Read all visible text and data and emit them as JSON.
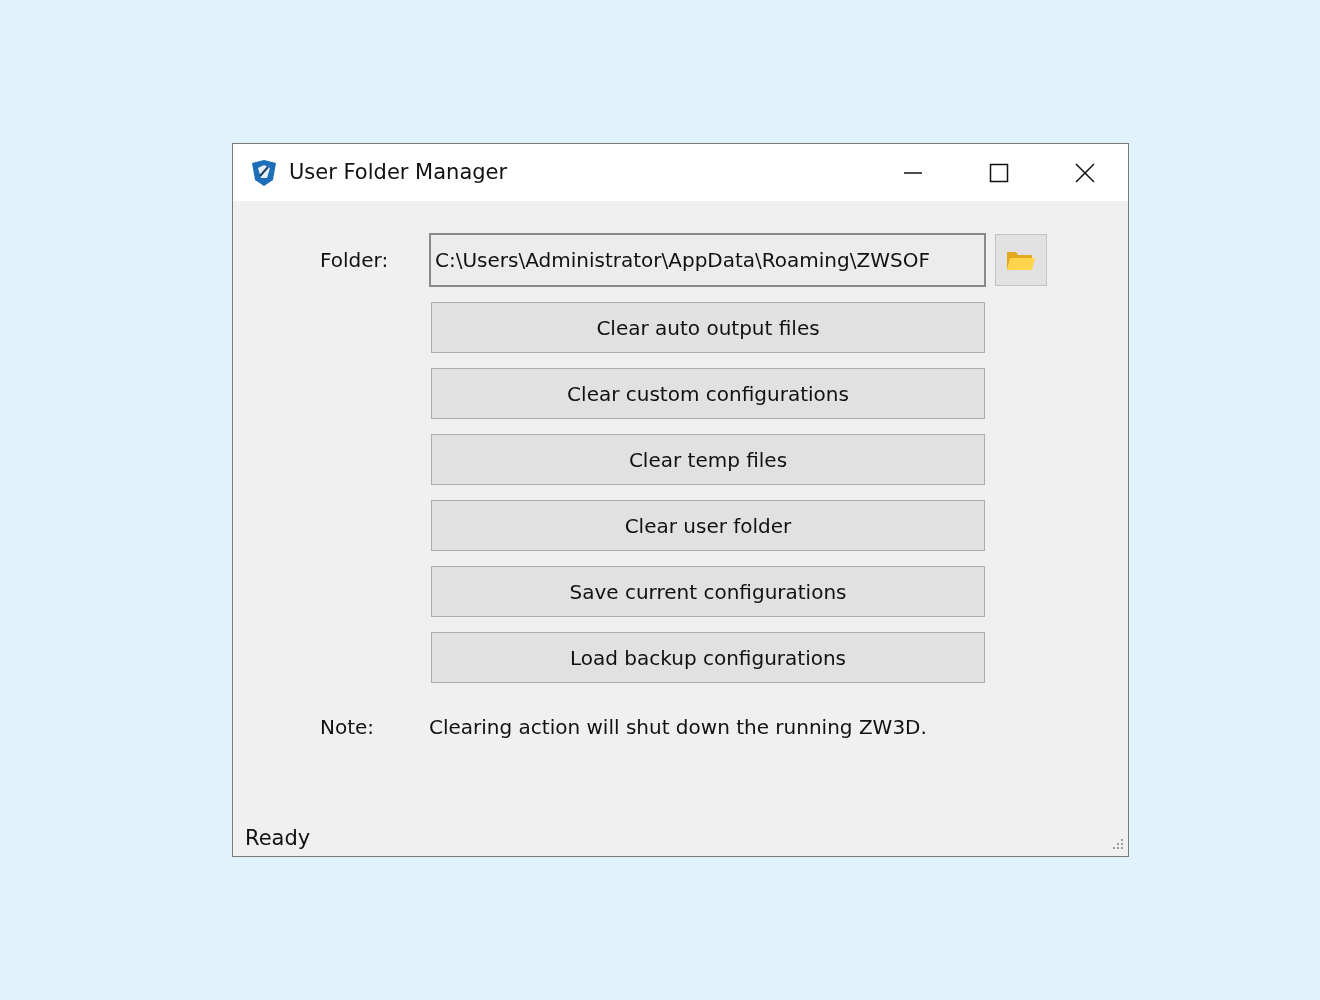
{
  "window": {
    "title": "User Folder Manager"
  },
  "folder": {
    "label": "Folder:",
    "value": "C:\\Users\\Administrator\\AppData\\Roaming\\ZWSOF"
  },
  "buttons": [
    "Clear auto output files",
    "Clear custom configurations",
    "Clear temp files",
    "Clear user folder",
    "Save current configurations",
    "Load backup configurations"
  ],
  "note": {
    "label": "Note:",
    "text": "Clearing action will shut down the running ZW3D."
  },
  "status_bar": "Ready"
}
